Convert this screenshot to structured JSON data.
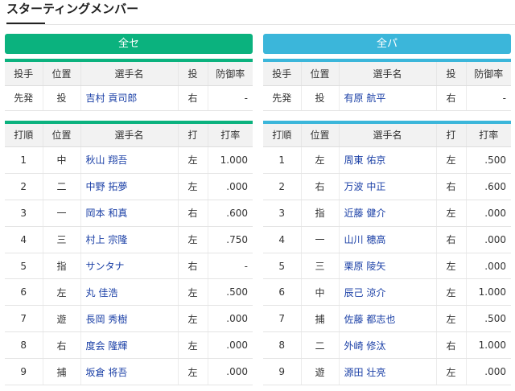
{
  "title": "スターティングメンバー",
  "headers": {
    "pitcher": [
      "投手",
      "位置",
      "選手名",
      "投",
      "防御率"
    ],
    "batter": [
      "打順",
      "位置",
      "選手名",
      "打",
      "打率"
    ]
  },
  "left": {
    "team_label": "全セ",
    "pitcher": {
      "role": "先発",
      "pos": "投",
      "name": "吉村 貢司郎",
      "hand": "右",
      "era": "-"
    },
    "batters": [
      {
        "order": "1",
        "pos": "中",
        "name": "秋山 翔吾",
        "hand": "左",
        "avg": "1.000"
      },
      {
        "order": "2",
        "pos": "二",
        "name": "中野 拓夢",
        "hand": "左",
        "avg": ".000"
      },
      {
        "order": "3",
        "pos": "一",
        "name": "岡本 和真",
        "hand": "右",
        "avg": ".600"
      },
      {
        "order": "4",
        "pos": "三",
        "name": "村上 宗隆",
        "hand": "左",
        "avg": ".750"
      },
      {
        "order": "5",
        "pos": "指",
        "name": "サンタナ",
        "hand": "右",
        "avg": "-"
      },
      {
        "order": "6",
        "pos": "左",
        "name": "丸 佳浩",
        "hand": "左",
        "avg": ".500"
      },
      {
        "order": "7",
        "pos": "遊",
        "name": "長岡 秀樹",
        "hand": "左",
        "avg": ".000"
      },
      {
        "order": "8",
        "pos": "右",
        "name": "度会 隆輝",
        "hand": "左",
        "avg": ".000"
      },
      {
        "order": "9",
        "pos": "捕",
        "name": "坂倉 将吾",
        "hand": "左",
        "avg": ".000"
      }
    ]
  },
  "right": {
    "team_label": "全パ",
    "pitcher": {
      "role": "先発",
      "pos": "投",
      "name": "有原 航平",
      "hand": "右",
      "era": "-"
    },
    "batters": [
      {
        "order": "1",
        "pos": "左",
        "name": "周東 佑京",
        "hand": "左",
        "avg": ".500"
      },
      {
        "order": "2",
        "pos": "右",
        "name": "万波 中正",
        "hand": "右",
        "avg": ".600"
      },
      {
        "order": "3",
        "pos": "指",
        "name": "近藤 健介",
        "hand": "左",
        "avg": ".000"
      },
      {
        "order": "4",
        "pos": "一",
        "name": "山川 穂高",
        "hand": "右",
        "avg": ".000"
      },
      {
        "order": "5",
        "pos": "三",
        "name": "栗原 陵矢",
        "hand": "左",
        "avg": ".000"
      },
      {
        "order": "6",
        "pos": "中",
        "name": "辰己 涼介",
        "hand": "左",
        "avg": "1.000"
      },
      {
        "order": "7",
        "pos": "捕",
        "name": "佐藤 都志也",
        "hand": "左",
        "avg": ".500"
      },
      {
        "order": "8",
        "pos": "二",
        "name": "外崎 修汰",
        "hand": "右",
        "avg": "1.000"
      },
      {
        "order": "9",
        "pos": "遊",
        "name": "源田 壮亮",
        "hand": "左",
        "avg": ".000"
      }
    ]
  },
  "colors": {
    "central": "#0bb27e",
    "pacific": "#3bb6da",
    "link": "#1a3fa6"
  }
}
